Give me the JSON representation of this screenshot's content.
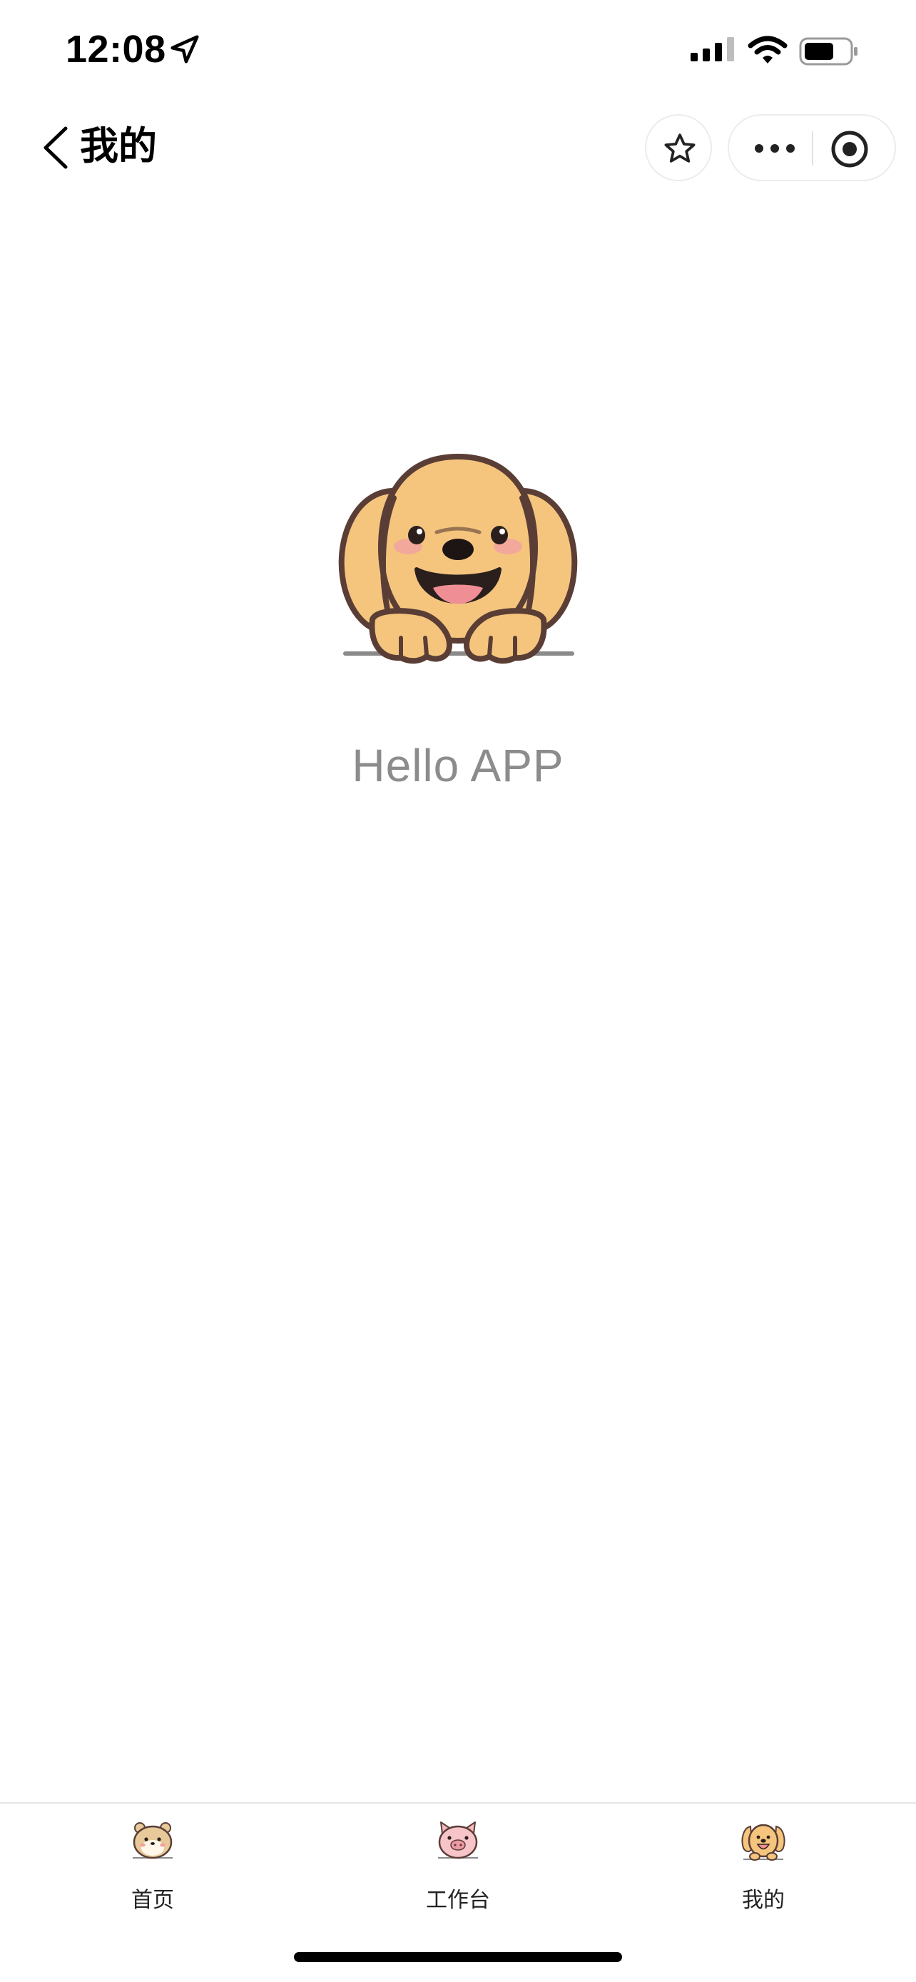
{
  "status_bar": {
    "time": "12:08",
    "location_icon": "location-arrow-icon",
    "signal_icon": "cellular-signal-icon",
    "wifi_icon": "wifi-icon",
    "battery_icon": "battery-icon"
  },
  "nav": {
    "title": "我的",
    "back_icon": "chevron-left-icon",
    "favorite_icon": "star-icon",
    "more_icon": "more-dots-icon",
    "close_icon": "target-circle-icon"
  },
  "main": {
    "mascot_icon": "puppy-mascot-icon",
    "hello_text": "Hello APP"
  },
  "tab_bar": {
    "tabs": [
      {
        "label": "首页",
        "icon": "hamster-icon"
      },
      {
        "label": "工作台",
        "icon": "piglet-icon"
      },
      {
        "label": "我的",
        "icon": "puppy-icon",
        "active": true
      }
    ]
  },
  "colors": {
    "dog_fur": "#f5c57e",
    "outline": "#5a3e36",
    "hello_text": "#8c8c8c",
    "divider": "#e6e6e6"
  }
}
